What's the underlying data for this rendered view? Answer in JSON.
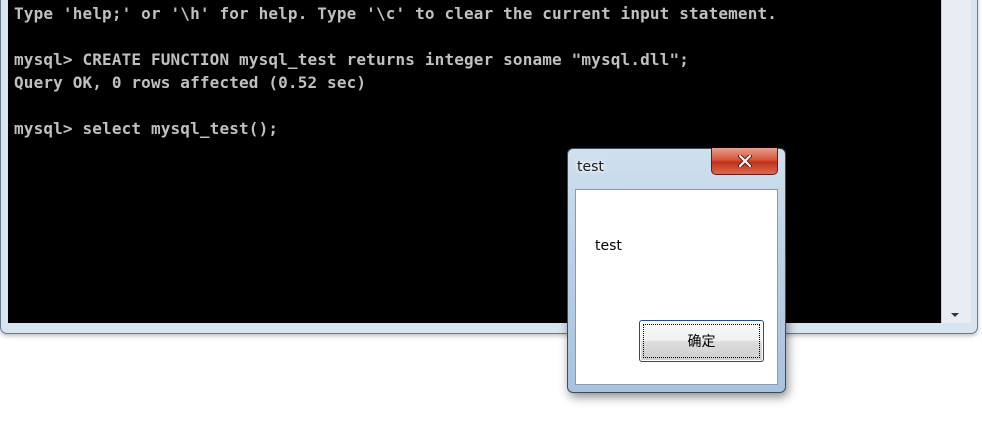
{
  "console": {
    "lines": [
      "Type 'help;' or '\\h' for help. Type '\\c' to clear the current input statement.",
      "",
      "mysql> CREATE FUNCTION mysql_test returns integer soname \"mysql.dll\";",
      "Query OK, 0 rows affected (0.52 sec)",
      "",
      "mysql> select mysql_test();"
    ],
    "text_color": "#c0c0c0",
    "background_color": "#000000"
  },
  "dialog": {
    "title": "test",
    "message": "test",
    "ok_label": "确定",
    "close_icon": "close-icon"
  }
}
